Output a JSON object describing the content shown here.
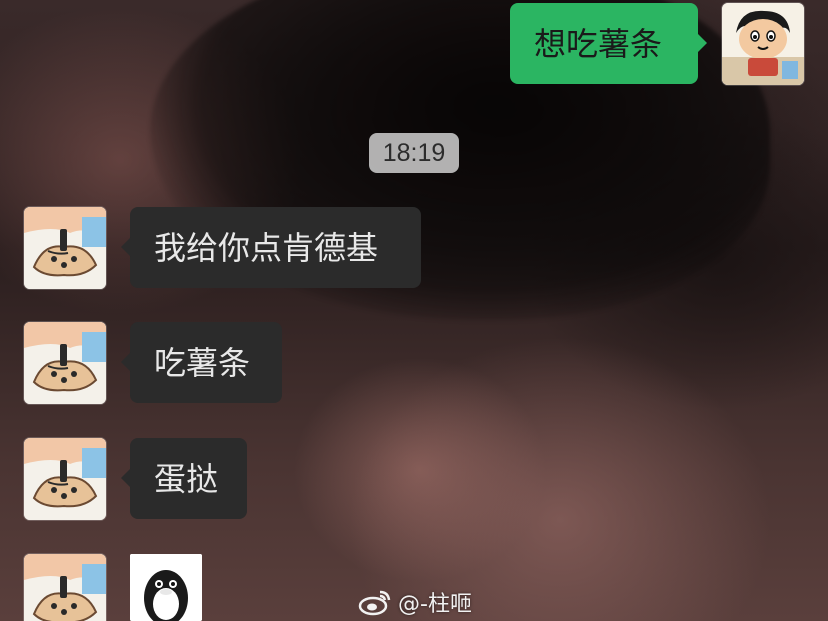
{
  "chat": {
    "timestamp": "18:19",
    "messages": [
      {
        "from": "me",
        "type": "text",
        "text": "想吃薯条"
      },
      {
        "from": "other",
        "type": "text",
        "text": "我给你点肯德基"
      },
      {
        "from": "other",
        "type": "text",
        "text": "吃薯条"
      },
      {
        "from": "other",
        "type": "text",
        "text": "蛋挞"
      },
      {
        "from": "other",
        "type": "sticker",
        "icon": "penguin-sticker-icon"
      }
    ]
  },
  "watermark": {
    "icon": "weibo-logo-icon",
    "text": "@-柱咂"
  },
  "colors": {
    "outgoing_bubble": "#2bb562",
    "incoming_bubble": "#2b2b2b",
    "timestamp_pill": "#d7d7d7"
  }
}
